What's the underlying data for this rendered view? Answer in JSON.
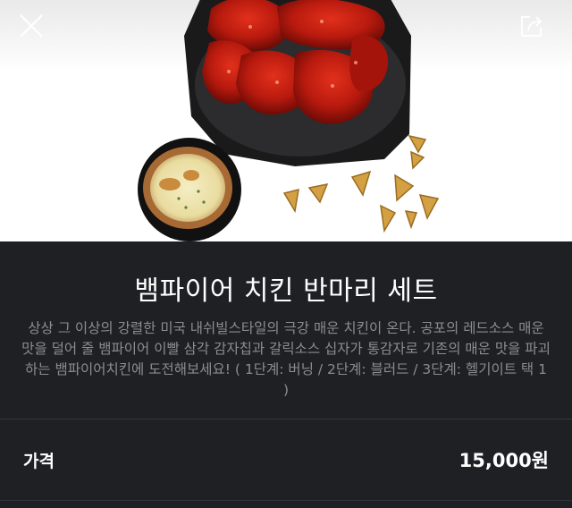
{
  "header": {
    "close_icon": "close-icon",
    "share_icon": "share-icon"
  },
  "product": {
    "image_alt": "product-photo",
    "name": "뱀파이어 치킨 반마리 세트",
    "description": "상상 그 이상의 강렬한 미국 내쉬빌스타일의 극강 매운 치킨이 온다. 공포의 레드소스 매운 맛을 덜어 줄 뱀파이어 이빨 삼각 감자칩과 갈릭소스 십자가 통감자로 기존의 매운 맛을 파괴하는 뱀파이어치킨에 도전해보세요! ( 1단계: 버닝 / 2단계: 블러드 / 3단계: 헬기이트 택 1 )"
  },
  "price": {
    "label": "가격",
    "value": "15,000원"
  },
  "colors": {
    "background": "#1f2024",
    "text_primary": "#ffffff",
    "text_secondary": "#8b8d93"
  }
}
